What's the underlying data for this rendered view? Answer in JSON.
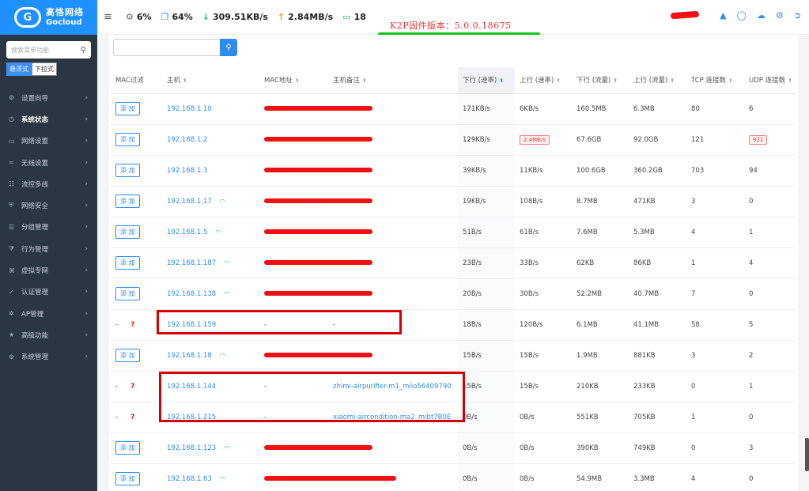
{
  "brand": {
    "line1": "高恪网络",
    "line2": "Gocloud",
    "mark": "G"
  },
  "sidebar": {
    "search_placeholder": "搜索菜单功能",
    "menu_style": [
      "悬浮式",
      "下拉式"
    ],
    "items": [
      {
        "label": "设置向导",
        "icon": "wand-icon"
      },
      {
        "label": "系统状态",
        "icon": "dashboard-icon",
        "active": true
      },
      {
        "label": "网络设置",
        "icon": "monitor-icon"
      },
      {
        "label": "无线设置",
        "icon": "wifi-icon"
      },
      {
        "label": "流控多线",
        "icon": "network-icon"
      },
      {
        "label": "网络安全",
        "icon": "shield-icon"
      },
      {
        "label": "分组管理",
        "icon": "list-icon"
      },
      {
        "label": "行为管理",
        "icon": "filter-icon"
      },
      {
        "label": "虚拟专网",
        "icon": "vpn-icon"
      },
      {
        "label": "认证管理",
        "icon": "auth-icon"
      },
      {
        "label": "AP管理",
        "icon": "ap-icon"
      },
      {
        "label": "高级功能",
        "icon": "pin-icon"
      },
      {
        "label": "系统管理",
        "icon": "gear-icon"
      }
    ]
  },
  "topbar": {
    "cpu": "6%",
    "mem": "64%",
    "down": "309.51KB/s",
    "up": "2.84MB/s",
    "devices": "18",
    "firmware": "K2P固件版本：5.0.0.18675"
  },
  "table": {
    "headers": [
      "MAC过滤",
      "主机",
      "MAC地址",
      "主机备注",
      "下行 (速率)",
      "上行 (速率)",
      "下行 (流量)",
      "上行 (流量)",
      "TCP 连接数",
      "UDP 连接数"
    ],
    "add_label": "添 加",
    "rows": [
      {
        "filter": "add",
        "ip": "192.168.1.10",
        "wifi": false,
        "mac": "scribble",
        "note": "scribble",
        "down_rate": "171KB/s",
        "up_rate": "6KB/s",
        "down_total": "160.5MB",
        "up_total": "6.3MB",
        "tcp": "80",
        "udp": "6"
      },
      {
        "filter": "add",
        "ip": "192.168.1.2",
        "wifi": false,
        "mac": "scribble",
        "note": "scribble",
        "down_rate": "129KB/s",
        "up_rate": "2.4MB/s",
        "up_rate_badge": true,
        "down_total": "67.6GB",
        "up_total": "92.0GB",
        "tcp": "121",
        "udp": "921",
        "udp_badge": true
      },
      {
        "filter": "add",
        "ip": "192.168.1.3",
        "wifi": false,
        "mac": "scribble",
        "note": "scribble",
        "down_rate": "39KB/s",
        "up_rate": "11KB/s",
        "down_total": "100.6GB",
        "up_total": "360.2GB",
        "tcp": "703",
        "udp": "94"
      },
      {
        "filter": "add",
        "ip": "192.168.1.17",
        "wifi": true,
        "mac": "scribble",
        "note": "scribble",
        "down_rate": "19KB/s",
        "up_rate": "108B/s",
        "down_total": "8.7MB",
        "up_total": "471KB",
        "tcp": "3",
        "udp": "0"
      },
      {
        "filter": "add",
        "ip": "192.168.1.5",
        "wifi": true,
        "mac": "scribble",
        "note": "scribble",
        "down_rate": "51B/s",
        "up_rate": "61B/s",
        "down_total": "7.6MB",
        "up_total": "5.3MB",
        "tcp": "4",
        "udp": "1"
      },
      {
        "filter": "add",
        "ip": "192.168.1.187",
        "wifi": true,
        "mac": "scribble",
        "note": "scribble",
        "down_rate": "23B/s",
        "up_rate": "33B/s",
        "down_total": "62KB",
        "up_total": "86KB",
        "tcp": "1",
        "udp": "4"
      },
      {
        "filter": "add",
        "ip": "192.168.1.138",
        "wifi": true,
        "mac": "scribble",
        "note": "scribble",
        "down_rate": "20B/s",
        "up_rate": "30B/s",
        "down_total": "52.2MB",
        "up_total": "40.7MB",
        "tcp": "7",
        "udp": "0"
      },
      {
        "filter": "unknown",
        "ip": "192.168.1.159",
        "wifi": false,
        "mac": "-",
        "note": "-",
        "down_rate": "18B/s",
        "up_rate": "120B/s",
        "down_total": "6.1MB",
        "up_total": "41.1MB",
        "tcp": "58",
        "udp": "5"
      },
      {
        "filter": "add",
        "ip": "192.168.1.18",
        "wifi": true,
        "mac": "scribble",
        "note": "scribble",
        "down_rate": "15B/s",
        "up_rate": "15B/s",
        "down_total": "1.9MB",
        "up_total": "881KB",
        "tcp": "3",
        "udp": "2"
      },
      {
        "filter": "unknown",
        "ip": "192.168.1.144",
        "wifi": false,
        "mac": "-",
        "note": "zhimi-airpurifier-m1_miio56409790",
        "down_rate": "15B/s",
        "up_rate": "15B/s",
        "down_total": "210KB",
        "up_total": "233KB",
        "tcp": "0",
        "udp": "1"
      },
      {
        "filter": "unknown",
        "ip": "192.168.1.215",
        "wifi": false,
        "mac": "-",
        "note": "xiaomi-aircondition-ma2_mibt7B0E",
        "down_rate": "0B/s",
        "up_rate": "0B/s",
        "down_total": "551KB",
        "up_total": "705KB",
        "tcp": "1",
        "udp": "0"
      },
      {
        "filter": "add",
        "ip": "192.168.1.123",
        "wifi": true,
        "mac": "scribble",
        "note": "scribble",
        "down_rate": "0B/s",
        "up_rate": "0B/s",
        "down_total": "390KB",
        "up_total": "749KB",
        "tcp": "0",
        "udp": "3"
      },
      {
        "filter": "add",
        "ip": "192.168.1.63",
        "wifi": true,
        "mac": "scribble",
        "note": "scribble",
        "down_rate": "0B/s",
        "up_rate": "0B/s",
        "down_total": "54.9MB",
        "up_total": "3.3MB",
        "tcp": "4",
        "udp": "0"
      }
    ]
  },
  "colors": {
    "accent": "#2d8cf0",
    "sidebar_bg": "#2b3643",
    "highlight_red": "#d40000",
    "underline_green": "#19c41c"
  }
}
